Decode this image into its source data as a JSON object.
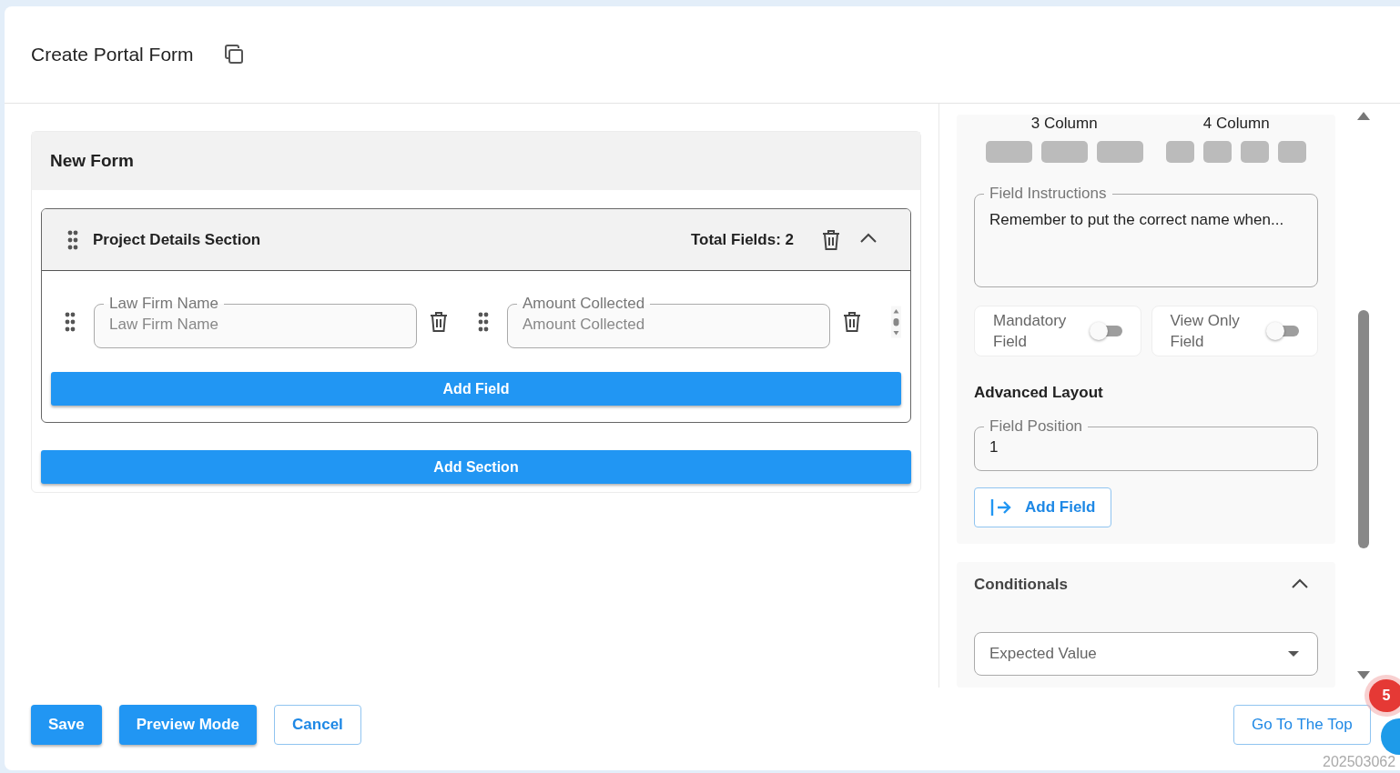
{
  "page": {
    "title": "Create Portal Form"
  },
  "form": {
    "title": "New Form",
    "sections": [
      {
        "title": "Project Details Section",
        "total": "Total Fields: 2",
        "expanded": true,
        "fields": [
          {
            "label": "Law Firm Name",
            "placeholder": "Law Firm Name"
          },
          {
            "label": "Amount Collected",
            "placeholder": "Amount Collected"
          }
        ],
        "add_field": "Add Field"
      }
    ],
    "add_section": "Add Section"
  },
  "settings": {
    "layouts": [
      {
        "label": "3 Column",
        "kind": "three"
      },
      {
        "label": "4 Column",
        "kind": "four"
      }
    ],
    "instructions": {
      "label": "Field Instructions",
      "value": "Remember to put the correct name when..."
    },
    "toggles": [
      {
        "label": "Mandatory Field",
        "on": false
      },
      {
        "label": "View Only Field",
        "on": false
      }
    ],
    "advanced_title": "Advanced Layout",
    "position": {
      "label": "Field Position",
      "value": "1"
    },
    "add_field": "Add Field",
    "conditionals": {
      "title": "Conditionals",
      "expanded": true,
      "select": {
        "placeholder": "Expected Value"
      }
    }
  },
  "footer": {
    "buttons": [
      {
        "label": "Save",
        "kind": "primary"
      },
      {
        "label": "Preview Mode",
        "kind": "primary"
      },
      {
        "label": "Cancel",
        "kind": "outline"
      }
    ],
    "go_top": "Go To The Top",
    "help_badge": "5",
    "build": "202503062"
  }
}
